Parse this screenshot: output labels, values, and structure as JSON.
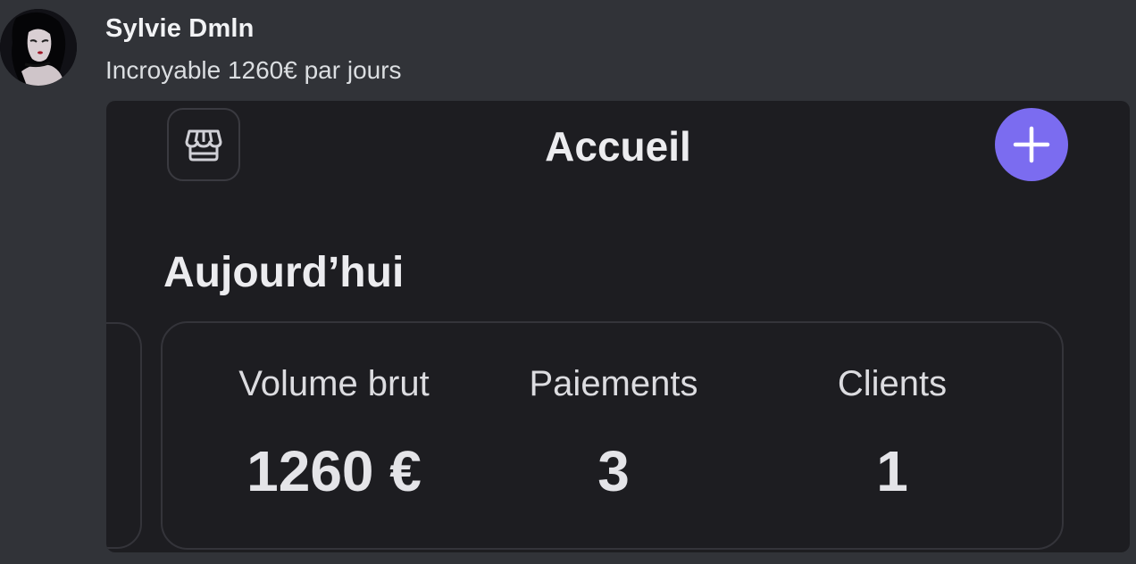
{
  "message": {
    "author": "Sylvie Dmln",
    "text": "Incroyable 1260€ par jours"
  },
  "app": {
    "title": "Accueil",
    "store_icon": "store-icon",
    "add_icon": "plus-icon",
    "accent_color": "#7b6cf0",
    "section_title": "Aujourd’hui",
    "stats": [
      {
        "label": "Volume brut",
        "value": "1260 €"
      },
      {
        "label": "Paiements",
        "value": "3"
      },
      {
        "label": "Clients",
        "value": "1"
      }
    ]
  }
}
